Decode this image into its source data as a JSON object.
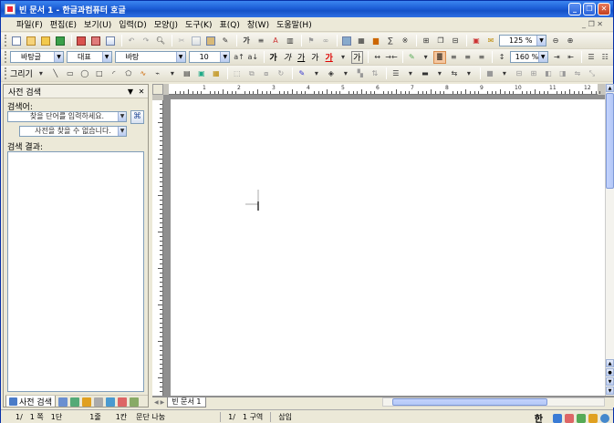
{
  "window": {
    "title": "빈 문서 1 - 한글과컴퓨터 호글"
  },
  "menu": {
    "items": [
      "파일(F)",
      "편집(E)",
      "보기(U)",
      "입력(D)",
      "모양(J)",
      "도구(K)",
      "표(Q)",
      "창(W)",
      "도움말(H)"
    ]
  },
  "toolbar2": {
    "style": "바탕글",
    "font_lang": "대표",
    "font": "바탕",
    "size": "10",
    "line_spacing": "160 %"
  },
  "toolbar1": {
    "zoom": "125 %"
  },
  "toolbar3": {
    "draw_label": "그리기"
  },
  "panel": {
    "title": "사전 검색",
    "search_label": "검색어:",
    "search_placeholder": "찾을 단어를 입력하세요.",
    "dictionary_value": "사전을 찾을 수 없습니다.",
    "result_label": "검색 결과:",
    "tab_label": "사전 검색"
  },
  "ruler": {
    "h_numbers": [
      "1",
      "2",
      "3",
      "4",
      "5",
      "6",
      "7",
      "8",
      "9",
      "10",
      "11",
      "12"
    ]
  },
  "document": {
    "tab": "빈 문서 1"
  },
  "status": {
    "items": [
      "1/",
      "1 쪽",
      "1단",
      "1줄",
      "1칸",
      "문단 나눔",
      "1/",
      "1 구역",
      "삽입"
    ]
  },
  "tray": {
    "ime": "한"
  }
}
